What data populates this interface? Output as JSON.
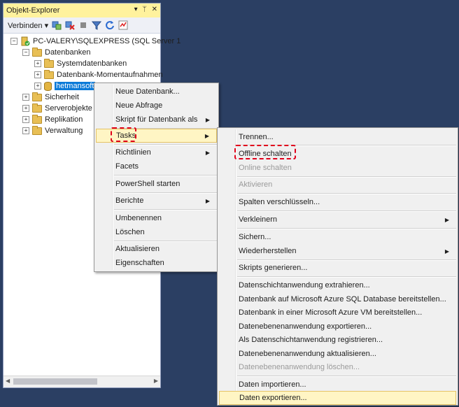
{
  "explorer": {
    "title": "Objekt-Explorer",
    "title_buttons": [
      "▾",
      "ᛘ",
      "✕"
    ],
    "toolbar": {
      "connect_label": "Verbinden",
      "connect_arrow": "▾"
    },
    "tree": {
      "server": "PC-VALERY\\SQLEXPRESS (SQL Server 1",
      "databases": "Datenbanken",
      "system_databases": "Systemdatenbanken",
      "snapshots": "Datenbank-Momentaufnahmen",
      "selected_db": "hetmansoft",
      "security": "Sicherheit",
      "server_objects": "Serverobjekte",
      "replication": "Replikation",
      "management": "Verwaltung"
    }
  },
  "context_menu": {
    "items": [
      "Neue Datenbank...",
      "Neue Abfrage",
      "Skript für Datenbank als",
      "Tasks",
      "Richtlinien",
      "Facets",
      "PowerShell starten",
      "Berichte",
      "Umbenennen",
      "Löschen",
      "Aktualisieren",
      "Eigenschaften"
    ]
  },
  "tasks_menu": {
    "items": [
      "Trennen...",
      "Offline schalten",
      "Online schalten",
      "Aktivieren",
      "Spalten verschlüsseln...",
      "Verkleinern",
      "Sichern...",
      "Wiederherstellen",
      "Skripts generieren...",
      "Datenschichtanwendung extrahieren...",
      "Datenbank auf Microsoft Azure SQL Database bereitstellen...",
      "Datenbank in einer Microsoft Azure VM bereitstellen...",
      "Datenebenenanwendung exportieren...",
      "Als Datenschichtanwendung registrieren...",
      "Datenebenenanwendung aktualisieren...",
      "Datenebenenanwendung löschen...",
      "Daten importieren...",
      "Daten exportieren..."
    ]
  },
  "colors": {
    "background": "#2b3f63",
    "menu_bg": "#f0f0f0",
    "highlight_bg": "#fff5c4",
    "highlight_border": "#e5c365",
    "annotation_red": "#e0001b",
    "selection_blue": "#0b7ad8"
  }
}
